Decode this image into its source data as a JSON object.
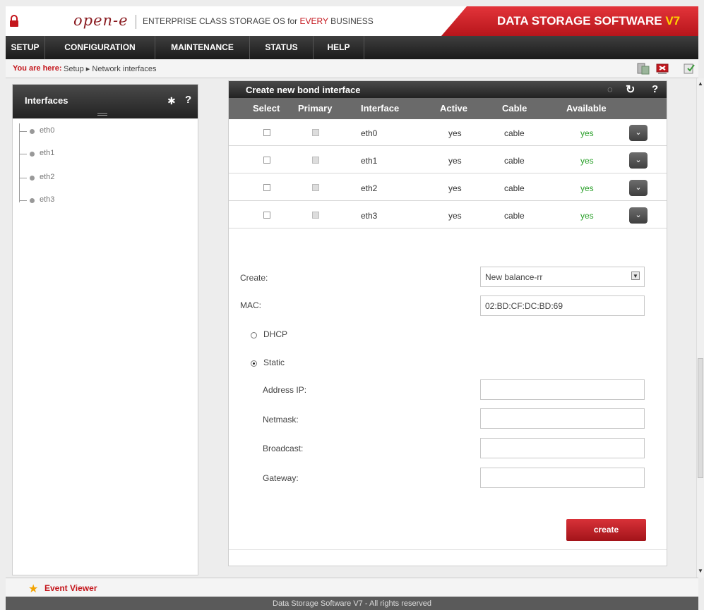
{
  "header": {
    "logo": "open-e",
    "tagline_prefix": "ENTERPRISE CLASS STORAGE OS for",
    "tagline_every": "EVERY",
    "tagline_suffix": "BUSINESS",
    "brand": "DATA STORAGE SOFTWARE",
    "brand_version": "V7"
  },
  "nav": {
    "items": [
      {
        "label": "SETUP"
      },
      {
        "label": "CONFIGURATION"
      },
      {
        "label": "MAINTENANCE"
      },
      {
        "label": "STATUS"
      },
      {
        "label": "HELP"
      }
    ]
  },
  "breadcrumb": {
    "label": "You are here:",
    "path": "Setup ▸ Network interfaces"
  },
  "left_panel": {
    "title": "Interfaces",
    "items": [
      {
        "label": "eth0"
      },
      {
        "label": "eth1"
      },
      {
        "label": "eth2"
      },
      {
        "label": "eth3"
      }
    ]
  },
  "main_panel": {
    "title": "Create new bond interface",
    "columns": [
      "Select",
      "Primary",
      "Interface",
      "Active",
      "Cable",
      "Available"
    ],
    "rows": [
      {
        "interface": "eth0",
        "active": "yes",
        "cable": "cable",
        "available": "yes"
      },
      {
        "interface": "eth1",
        "active": "yes",
        "cable": "cable",
        "available": "yes"
      },
      {
        "interface": "eth2",
        "active": "yes",
        "cable": "cable",
        "available": "yes"
      },
      {
        "interface": "eth3",
        "active": "yes",
        "cable": "cable",
        "available": "yes"
      }
    ],
    "form": {
      "create_label": "Create:",
      "create_value": "New balance-rr",
      "mac_label": "MAC:",
      "mac_value": "02:BD:CF:DC:BD:69",
      "dhcp_label": "DHCP",
      "static_label": "Static",
      "selected_mode": "Static",
      "address_label": "Address IP:",
      "address_value": "",
      "netmask_label": "Netmask:",
      "netmask_value": "",
      "broadcast_label": "Broadcast:",
      "broadcast_value": "",
      "gateway_label": "Gateway:",
      "gateway_value": "",
      "create_button": "create"
    }
  },
  "event_viewer": {
    "label": "Event Viewer"
  },
  "footer": {
    "text": "Data Storage Software V7 - All rights reserved"
  },
  "colors": {
    "accent": "#c4161c",
    "brand_red": "#d3222a",
    "available_green": "#2aa02a"
  }
}
